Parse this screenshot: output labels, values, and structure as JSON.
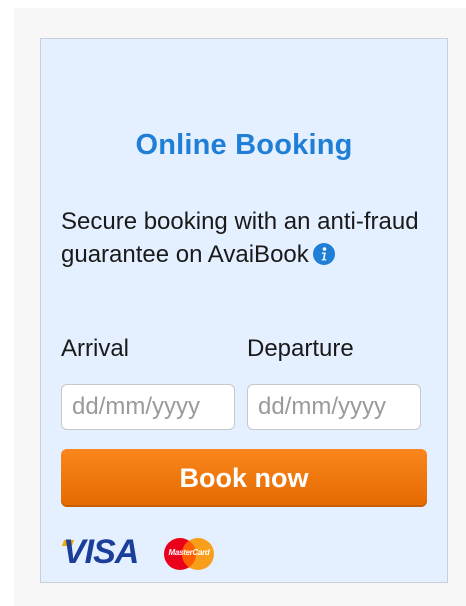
{
  "widget": {
    "title": "Online Booking",
    "description": "Secure booking with an anti-fraud guarantee on AvaiBook",
    "info_icon": "info-icon"
  },
  "dates": {
    "arrival_label": "Arrival",
    "departure_label": "Departure",
    "arrival_placeholder": "dd/mm/yyyy",
    "departure_placeholder": "dd/mm/yyyy",
    "arrival_value": "",
    "departure_value": ""
  },
  "actions": {
    "book_label": "Book now"
  },
  "payment": {
    "visa_text": "VISA",
    "mastercard_text": "MasterCard"
  },
  "colors": {
    "title": "#1f7fd6",
    "panel_bg": "#e4efff",
    "button": "#f07800",
    "visa": "#1a3e9a",
    "mastercard_red": "#eb001b",
    "mastercard_orange": "#f79e1b"
  }
}
